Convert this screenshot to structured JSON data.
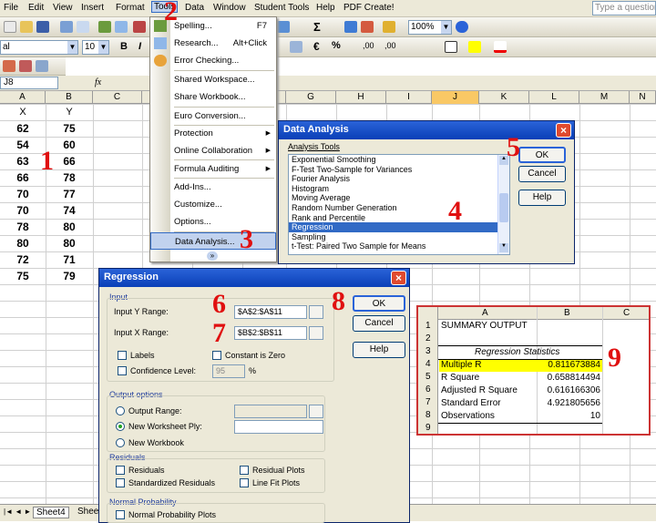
{
  "menubar": {
    "items": [
      "File",
      "Edit",
      "View",
      "Insert",
      "Format",
      "Tools",
      "Data",
      "Window",
      "Student Tools",
      "Help",
      "PDF Create!"
    ],
    "ask_placeholder": "Type a question"
  },
  "toolbar": {
    "font_name": "al",
    "font_size": "10",
    "zoom": "100%",
    "bold": "B",
    "italic": "I",
    "sigma": "Σ",
    "euro": "€",
    "percent": "%",
    "inc_dec": ",00",
    "dec_dec": ",00"
  },
  "formula": {
    "name_box": "J8",
    "fx": "fx"
  },
  "columns": [
    "A",
    "B",
    "C",
    "D",
    "E",
    "F",
    "G",
    "H",
    "I",
    "J",
    "K",
    "L",
    "M",
    "N"
  ],
  "selected_column": "J",
  "sheet": {
    "header_row": [
      "X",
      "Y"
    ],
    "rows": [
      [
        "62",
        "75"
      ],
      [
        "54",
        "60"
      ],
      [
        "63",
        "66"
      ],
      [
        "66",
        "78"
      ],
      [
        "70",
        "77"
      ],
      [
        "70",
        "74"
      ],
      [
        "78",
        "80"
      ],
      [
        "80",
        "80"
      ],
      [
        "72",
        "71"
      ],
      [
        "75",
        "79"
      ]
    ]
  },
  "sheet_tabs": {
    "nav": "|◄ ◄ ► ►|",
    "tabs": [
      "Sheet4",
      "Shee"
    ]
  },
  "tools_menu": {
    "items": [
      {
        "label": "Spelling...",
        "shortcut": "F7",
        "icon": "spelling-icon"
      },
      {
        "label": "Research...",
        "shortcut": "Alt+Click",
        "icon": "research-icon"
      },
      {
        "label": "Error Checking...",
        "shortcut": "",
        "icon": "error-check-icon"
      },
      {
        "label": "Shared Workspace...",
        "shortcut": ""
      },
      {
        "label": "Share Workbook...",
        "shortcut": ""
      },
      {
        "label": "Euro Conversion...",
        "shortcut": ""
      },
      {
        "label": "Protection",
        "submenu": true
      },
      {
        "label": "Online Collaboration",
        "submenu": true
      },
      {
        "label": "Formula Auditing",
        "submenu": true
      },
      {
        "label": "Add-Ins...",
        "shortcut": ""
      },
      {
        "label": "Customize...",
        "shortcut": ""
      },
      {
        "label": "Options...",
        "shortcut": ""
      },
      {
        "label": "Data Analysis...",
        "shortcut": "",
        "highlighted": true
      }
    ],
    "more": "»"
  },
  "data_analysis": {
    "title": "Data Analysis",
    "list_label": "Analysis Tools",
    "tools": [
      "Exponential Smoothing",
      "F-Test Two-Sample for Variances",
      "Fourier Analysis",
      "Histogram",
      "Moving Average",
      "Random Number Generation",
      "Rank and Percentile",
      "Regression",
      "Sampling",
      "t-Test: Paired Two Sample for Means"
    ],
    "selected": "Regression",
    "ok": "OK",
    "cancel": "Cancel",
    "help": "Help"
  },
  "regression": {
    "title": "Regression",
    "input_group": "Input",
    "y_label": "Input Y Range:",
    "y_value": "$A$2:$A$11",
    "x_label": "Input X Range:",
    "x_value": "$B$2:$B$11",
    "labels": "Labels",
    "constant_zero": "Constant is Zero",
    "confidence": "Confidence Level:",
    "confidence_value": "95",
    "percent": "%",
    "output_group": "Output options",
    "output_range": "Output Range:",
    "new_ply": "New Worksheet Ply:",
    "new_workbook": "New Workbook",
    "residuals_group": "Residuals",
    "residuals": "Residuals",
    "residual_plots": "Residual Plots",
    "std_residuals": "Standardized Residuals",
    "line_fit": "Line Fit Plots",
    "normal_group": "Normal Probability",
    "normal_plots": "Normal Probability Plots",
    "ok": "OK",
    "cancel": "Cancel",
    "help": "Help"
  },
  "summary": {
    "cols": [
      "A",
      "B",
      "C"
    ],
    "row_numbers": [
      "1",
      "2",
      "3",
      "4",
      "5",
      "6",
      "7",
      "8",
      "9"
    ],
    "title": "SUMMARY OUTPUT",
    "stats_header": "Regression Statistics",
    "stats": [
      {
        "label": "Multiple R",
        "value": "0.811673884",
        "highlight": true
      },
      {
        "label": "R Square",
        "value": "0.658814494"
      },
      {
        "label": "Adjusted R Square",
        "value": "0.616166306"
      },
      {
        "label": "Standard Error",
        "value": "4.921805656"
      },
      {
        "label": "Observations",
        "value": "10"
      }
    ]
  },
  "callouts": [
    "1",
    "2",
    "3",
    "4",
    "5",
    "6",
    "7",
    "8",
    "9"
  ],
  "colors": {
    "callout": "#e01010",
    "title_bar": "#0a3fb7",
    "selection": "#316ac5",
    "highlight_yellow": "#ffff00"
  }
}
